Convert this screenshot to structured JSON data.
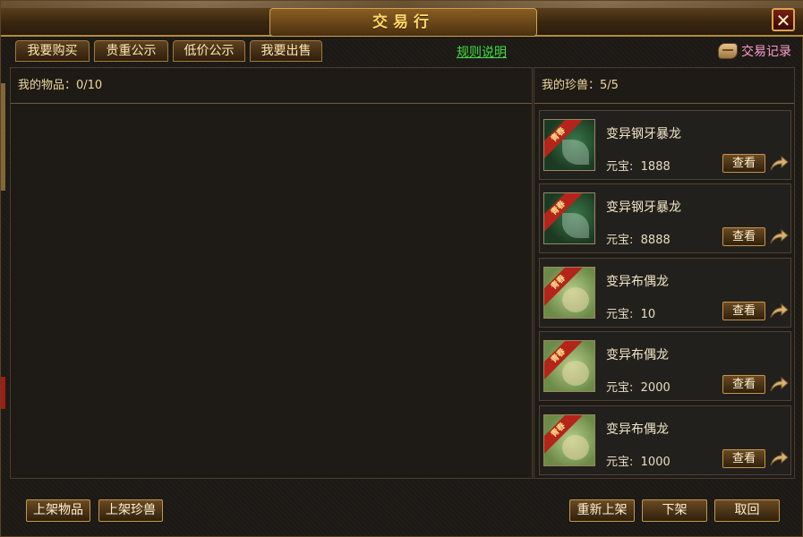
{
  "window": {
    "title": "交易行"
  },
  "tabs": [
    {
      "label": "我要购买"
    },
    {
      "label": "贵重公示"
    },
    {
      "label": "低价公示"
    },
    {
      "label": "我要出售"
    }
  ],
  "rules_link": "规则说明",
  "trade_log": {
    "label": "交易记录",
    "icon": "scroll-icon"
  },
  "left_panel": {
    "header": "我的物品：0/10"
  },
  "right_panel": {
    "header": "我的珍兽：5/5",
    "pets": [
      {
        "ribbon": "青春",
        "name": "变异钢牙暴龙",
        "price_label": "元宝:",
        "price": "1888",
        "view_label": "查看",
        "kind": "dragon"
      },
      {
        "ribbon": "青春",
        "name": "变异钢牙暴龙",
        "price_label": "元宝:",
        "price": "8888",
        "view_label": "查看",
        "kind": "dragon"
      },
      {
        "ribbon": "青春",
        "name": "变异布偶龙",
        "price_label": "元宝:",
        "price": "10",
        "view_label": "查看",
        "kind": "doll"
      },
      {
        "ribbon": "青春",
        "name": "变异布偶龙",
        "price_label": "元宝:",
        "price": "2000",
        "view_label": "查看",
        "kind": "doll"
      },
      {
        "ribbon": "青春",
        "name": "变异布偶龙",
        "price_label": "元宝:",
        "price": "1000",
        "view_label": "查看",
        "kind": "doll"
      }
    ]
  },
  "bottom_left": {
    "list_item": "上架物品",
    "list_pet": "上架珍兽"
  },
  "bottom_right": {
    "relist": "重新上架",
    "delist": "下架",
    "cancel": "取回"
  },
  "colors": {
    "gold": "#ffd76a",
    "link_green": "#3ee03e",
    "log_pink": "#ff9ccf"
  }
}
